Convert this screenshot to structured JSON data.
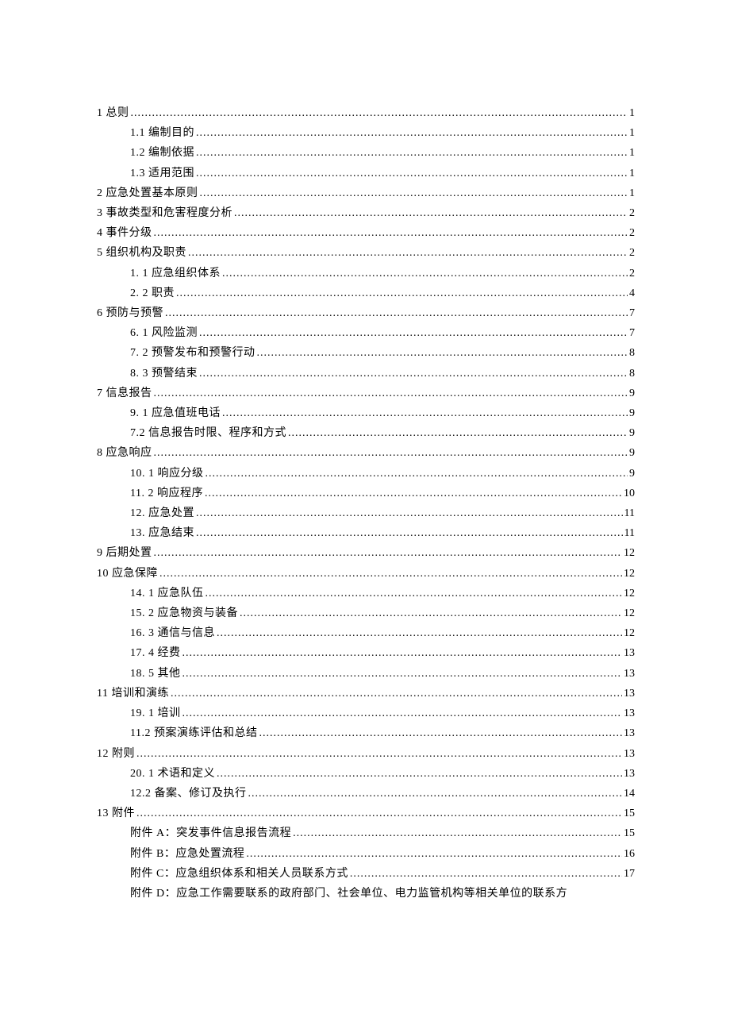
{
  "toc": [
    {
      "level": 1,
      "title": "1 总则",
      "page": "1"
    },
    {
      "level": 2,
      "title": "1.1  编制目的 ",
      "page": "1"
    },
    {
      "level": 2,
      "title": "1.2  编制依据 ",
      "page": "1"
    },
    {
      "level": 2,
      "title": "1.3  适用范围 ",
      "page": "1"
    },
    {
      "level": 1,
      "title": "2 应急处置基本原则",
      "page": "1"
    },
    {
      "level": 1,
      "title": "3 事故类型和危害程度分析",
      "page": "2"
    },
    {
      "level": 1,
      "title": "4 事件分级",
      "page": "2"
    },
    {
      "level": 1,
      "title": "5 组织机构及职责",
      "page": "2"
    },
    {
      "level": 2,
      "title": "1.  1 应急组织体系 ",
      "page": "2"
    },
    {
      "level": 2,
      "title": "2.  2 职责 ",
      "page": "4"
    },
    {
      "level": 1,
      "title": "6 预防与预警",
      "page": "7"
    },
    {
      "level": 2,
      "title": "6.  1 风险监测 ",
      "page": "7"
    },
    {
      "level": 2,
      "title": "7.  2 预警发布和预警行动 ",
      "page": "8"
    },
    {
      "level": 2,
      "title": "8.  3 预警结束 ",
      "page": "8"
    },
    {
      "level": 1,
      "title": "7 信息报告",
      "page": "9"
    },
    {
      "level": 2,
      "title": "9.  1 应急值班电话 ",
      "page": "9"
    },
    {
      "level": 2,
      "title": "7.2 信息报告时限、程序和方式 ",
      "page": "9"
    },
    {
      "level": 1,
      "title": "8 应急响应",
      "page": "9"
    },
    {
      "level": 2,
      "title": "10. 1 响应分级 ",
      "page": "9"
    },
    {
      "level": 2,
      "title": "11. 2 响应程序 ",
      "page": "10"
    },
    {
      "level": 2,
      "title": "12.  应急处置 ",
      "page": "11"
    },
    {
      "level": 2,
      "title": "13.  应急结束 ",
      "page": "11"
    },
    {
      "level": 1,
      "title": "9 后期处置",
      "page": "12"
    },
    {
      "level": 1,
      "title": "10 应急保障",
      "page": "12"
    },
    {
      "level": 2,
      "title": "14.  1 应急队伍 ",
      "page": "12"
    },
    {
      "level": 2,
      "title": "15.  2 应急物资与装备 ",
      "page": "12"
    },
    {
      "level": 2,
      "title": "16.  3 通信与信息 ",
      "page": "12"
    },
    {
      "level": 2,
      "title": "17.  4 经费 ",
      "page": "13"
    },
    {
      "level": 2,
      "title": "18.  5 其他 ",
      "page": "13"
    },
    {
      "level": 1,
      "title": "11 培训和演练",
      "page": "13"
    },
    {
      "level": 2,
      "title": "19.  1 培训 ",
      "page": "13"
    },
    {
      "level": 2,
      "title": "11.2 预案演练评估和总结 ",
      "page": "13"
    },
    {
      "level": 1,
      "title": "12 附则",
      "page": "13"
    },
    {
      "level": 2,
      "title": "20.  1 术语和定义 ",
      "page": "13"
    },
    {
      "level": 2,
      "title": "12.2 备案、修订及执行 ",
      "page": "14"
    },
    {
      "level": 1,
      "title": "13 附件",
      "page": "15"
    },
    {
      "level": 2,
      "title": "附件 A：突发事件信息报告流程 ",
      "page": "15"
    },
    {
      "level": 2,
      "title": "附件 B：应急处置流程 ",
      "page": "16"
    },
    {
      "level": 2,
      "title": "附件 C：应急组织体系和相关人员联系方式 ",
      "page": "17"
    },
    {
      "level": 2,
      "title": "附件 D：应急工作需要联系的政府部门、社会单位、电力监管机构等相关单位的联系方",
      "page": null
    }
  ]
}
